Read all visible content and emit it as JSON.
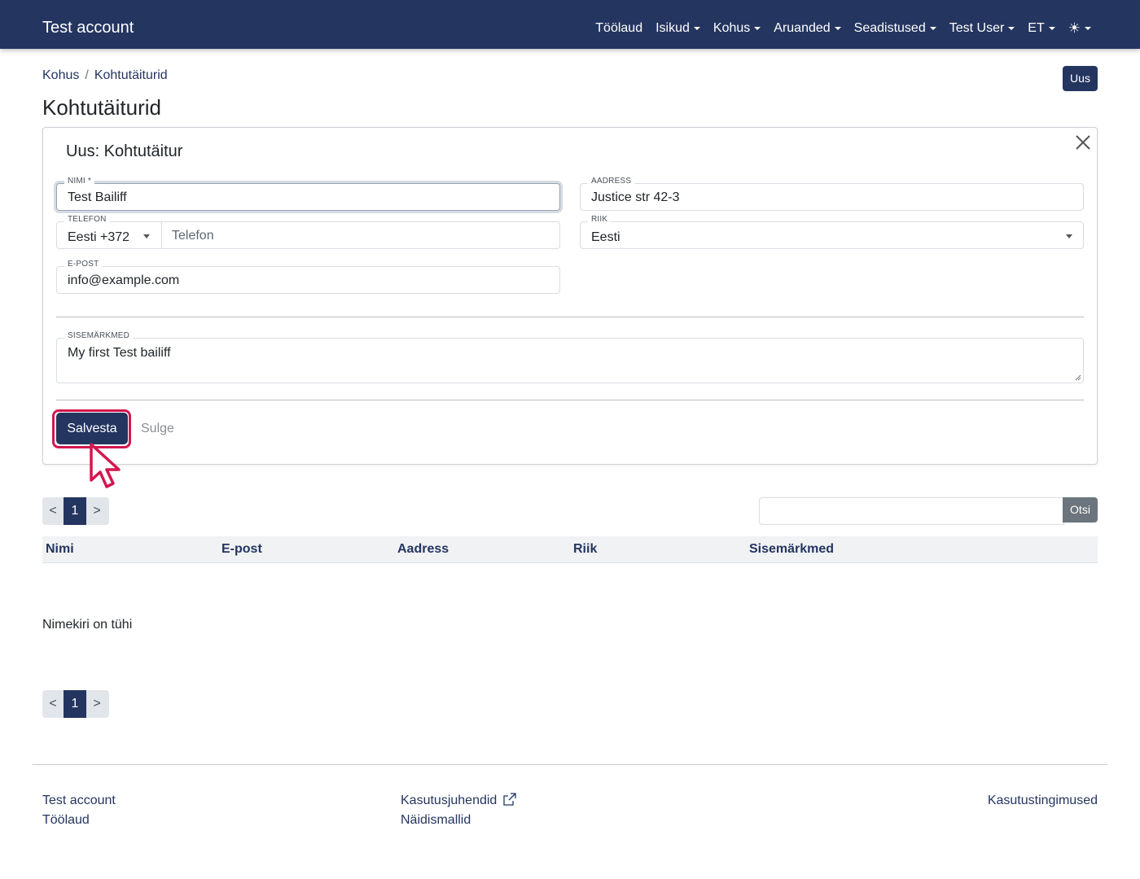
{
  "navbar": {
    "brand": "Test account",
    "items": [
      {
        "label": "Töölaud",
        "dropdown": false
      },
      {
        "label": "Isikud",
        "dropdown": true
      },
      {
        "label": "Kohus",
        "dropdown": true
      },
      {
        "label": "Aruanded",
        "dropdown": true
      },
      {
        "label": "Seadistused",
        "dropdown": true
      },
      {
        "label": "Test User",
        "dropdown": true
      },
      {
        "label": "ET",
        "dropdown": true
      }
    ],
    "theme_icon": "sun-icon",
    "theme_glyph": "☀"
  },
  "breadcrumb": {
    "items": [
      "Kohus",
      "Kohtutäiturid"
    ],
    "separator": "/"
  },
  "header": {
    "new_button": "Uus",
    "title": "Kohtutäiturid"
  },
  "form": {
    "title": "Uus: Kohtutäitur",
    "name": {
      "label": "NIMI *",
      "value": "Test Bailiff"
    },
    "address": {
      "label": "AADRESS",
      "value": "Justice str 42-3"
    },
    "phone": {
      "label": "TELEFON",
      "country_code": "Eesti +372",
      "placeholder": "Telefon"
    },
    "country": {
      "label": "RIIK",
      "value": "Eesti"
    },
    "email": {
      "label": "E-POST",
      "value": "info@example.com"
    },
    "notes": {
      "label": "SISEMÄRKMED",
      "value": "My first Test bailiff"
    },
    "save_button": "Salvesta",
    "close_button": "Sulge"
  },
  "pagination": {
    "prev": "<",
    "current": "1",
    "next": ">"
  },
  "search": {
    "button": "Otsi",
    "value": ""
  },
  "table": {
    "columns": [
      "Nimi",
      "E-post",
      "Aadress",
      "Riik",
      "Sisemärkmed"
    ],
    "empty_message": "Nimekiri on tühi"
  },
  "footer": {
    "col1": [
      "Test account",
      "Töölaud"
    ],
    "col2": [
      "Kasutusjuhendid",
      "Näidismallid"
    ],
    "col3": [
      "Kasutustingimused"
    ]
  },
  "colors": {
    "primary": "#243560",
    "highlight": "#d3164f",
    "secondary": "#6c757d"
  }
}
